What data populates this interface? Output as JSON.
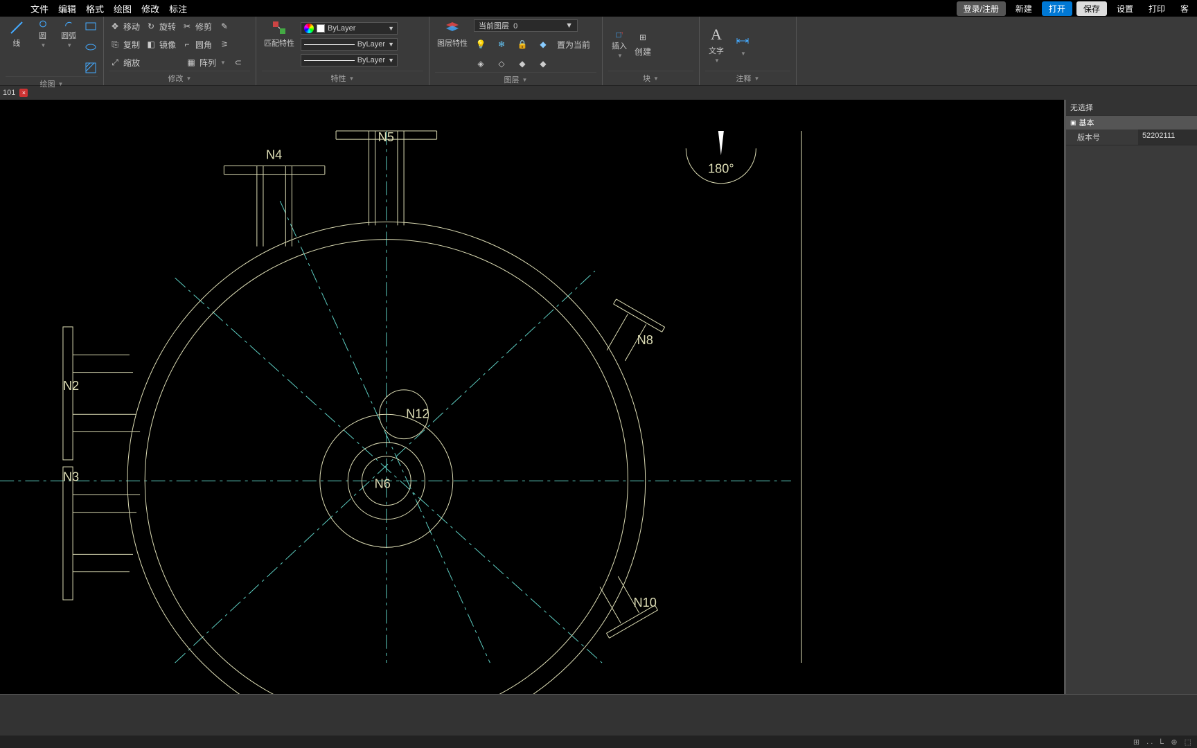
{
  "menu": {
    "items": [
      "文件",
      "编辑",
      "格式",
      "绘图",
      "修改",
      "标注"
    ],
    "login": "登录/注册",
    "new": "新建",
    "open": "打开",
    "save": "保存",
    "settings": "设置",
    "print": "打印",
    "service": "客"
  },
  "ribbon": {
    "panel_draw": {
      "label": "绘图",
      "line": "线",
      "circle": "圆",
      "arc": "圆弧"
    },
    "panel_modify": {
      "label": "修改",
      "move": "移动",
      "rotate": "旋转",
      "trim": "修剪",
      "copy": "复制",
      "mirror": "镜像",
      "fillet": "圆角",
      "scale": "缩放",
      "array": "阵列"
    },
    "panel_props": {
      "label": "特性",
      "match": "匹配特性",
      "bylayer1": "ByLayer",
      "bylayer2": "ByLayer",
      "bylayer3": "ByLayer"
    },
    "panel_layer": {
      "label": "图层",
      "props": "图层特性",
      "current_label": "当前图层",
      "current_val": "0",
      "set_current": "置为当前"
    },
    "panel_block": {
      "label": "块",
      "insert": "插入",
      "create": "创建"
    },
    "panel_annot": {
      "label": "注释",
      "text": "文字"
    }
  },
  "doctab": {
    "name": "101",
    "close": "×"
  },
  "canvas": {
    "labels": {
      "n2": "N2",
      "n3": "N3",
      "n4": "N4",
      "n5": "N5",
      "n6": "N6",
      "n8": "N8",
      "n10": "N10",
      "n12": "N12"
    },
    "angle": "180°"
  },
  "props": {
    "no_sel": "无选择",
    "section": "基本",
    "version_label": "版本号",
    "version_value": "52202111"
  },
  "status": {
    "grid": "⊞",
    "snap": ". .",
    "ortho": "L",
    "polar": "⊕",
    "osnap": "⬚"
  }
}
